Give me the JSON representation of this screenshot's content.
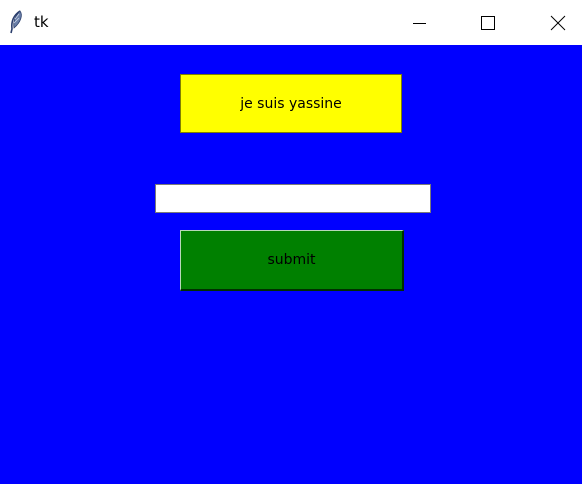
{
  "window": {
    "title": "tk",
    "background_color": "#0000ff"
  },
  "titlebar": {
    "minimize_icon": "minimize-icon",
    "maximize_icon": "maximize-icon",
    "close_icon": "close-icon",
    "app_icon": "feather-icon"
  },
  "main": {
    "label_text": "je suis yassine",
    "label_color": "#ffff00",
    "entry_value": "",
    "submit_label": "submit",
    "submit_color": "#008000"
  }
}
